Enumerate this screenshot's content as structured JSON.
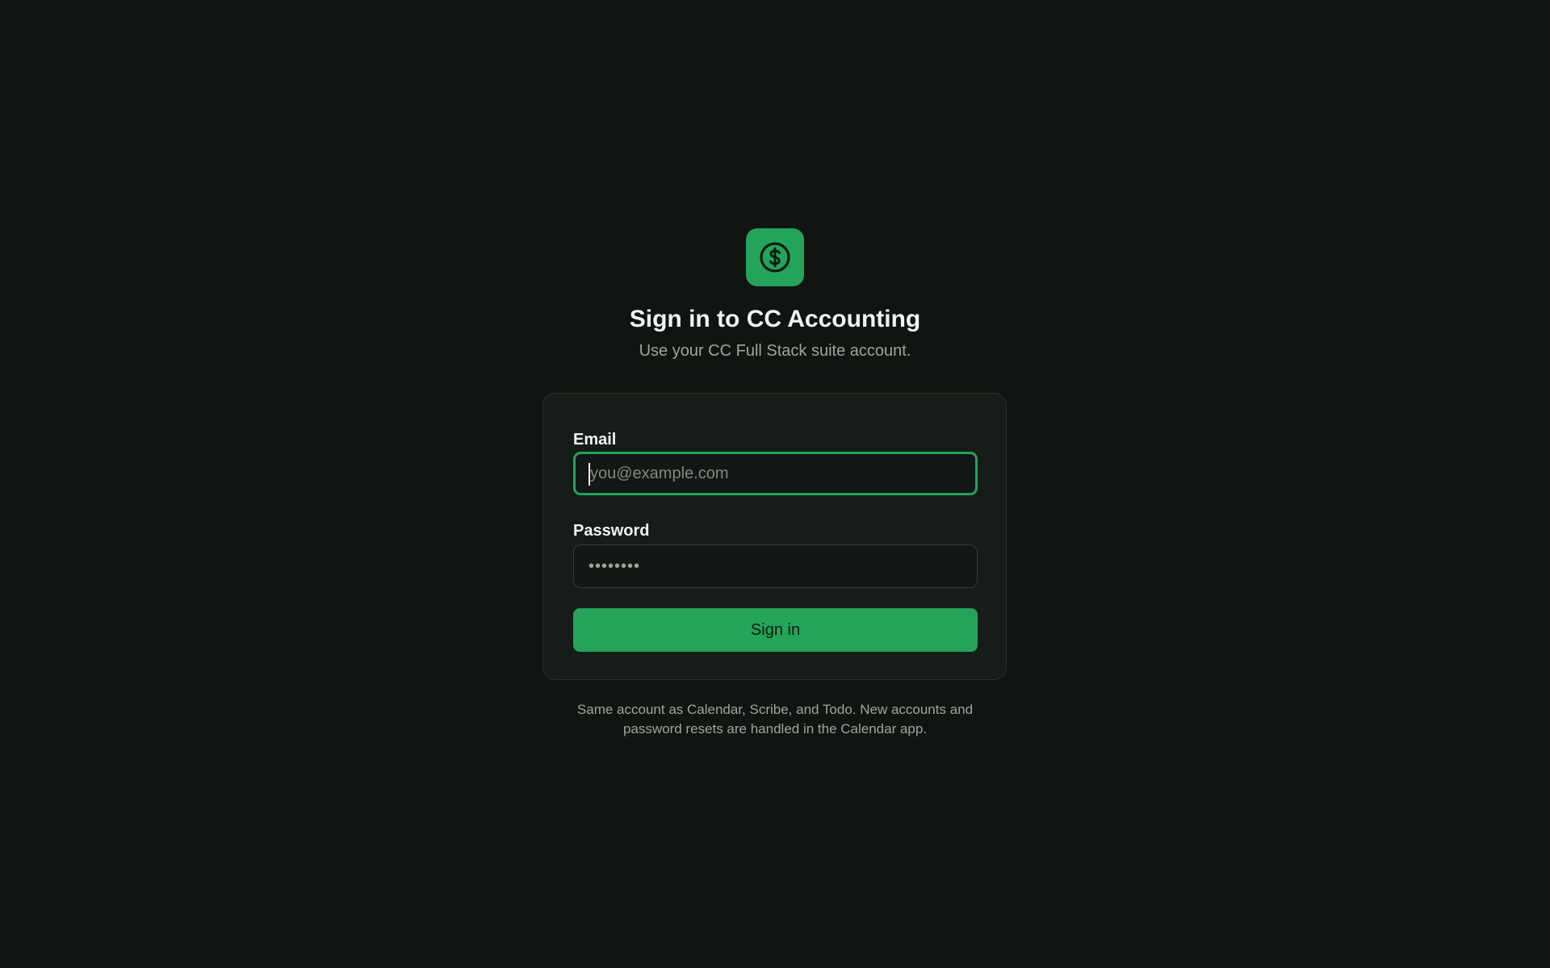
{
  "brand": {
    "logo_icon": "dollar-coin-icon",
    "accent_color": "#23a45a",
    "background_color": "#101512"
  },
  "header": {
    "title": "Sign in to CC Accounting",
    "subtitle": "Use your CC Full Stack suite account."
  },
  "form": {
    "email": {
      "label": "Email",
      "placeholder": "you@example.com",
      "value": ""
    },
    "password": {
      "label": "Password",
      "placeholder": "••••••••",
      "value": ""
    },
    "submit_label": "Sign in"
  },
  "footer": {
    "line1": "Same account as Calendar, Scribe, and Todo. New accounts and",
    "line2": "password resets are handled in the Calendar app."
  }
}
